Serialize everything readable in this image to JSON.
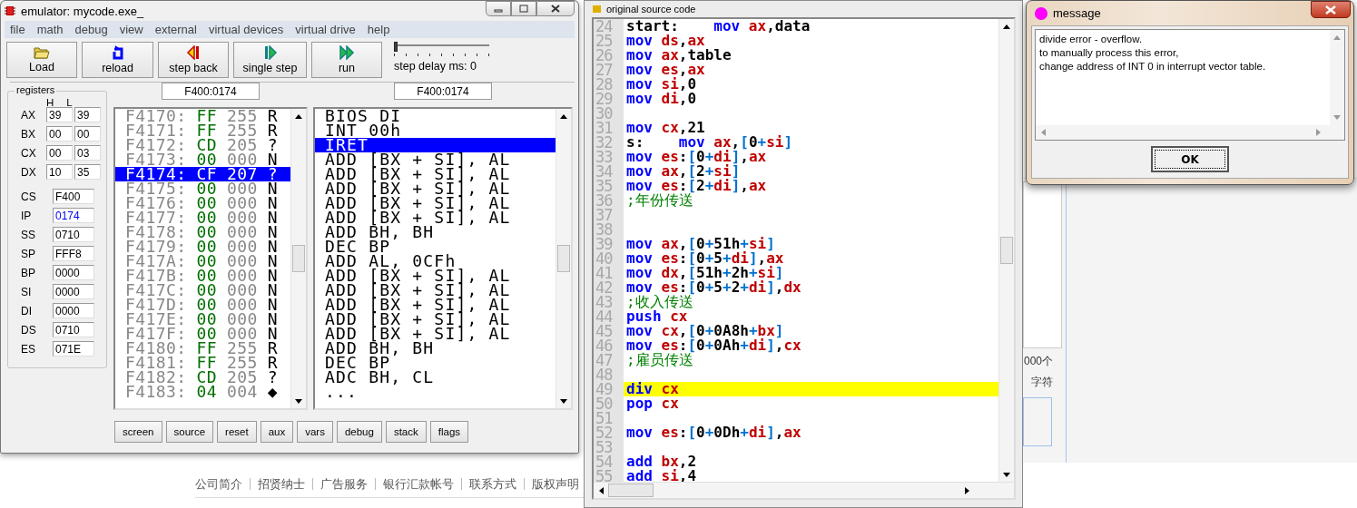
{
  "emulator": {
    "title": "emulator: mycode.exe_",
    "menu": [
      "file",
      "math",
      "debug",
      "view",
      "external",
      "virtual devices",
      "virtual drive",
      "help"
    ],
    "toolbar": [
      {
        "label": "Load",
        "kind": "load"
      },
      {
        "label": "reload",
        "kind": "reload"
      },
      {
        "label": "step back",
        "kind": "back"
      },
      {
        "label": "single step",
        "kind": "step"
      },
      {
        "label": "run",
        "kind": "run"
      }
    ],
    "step_delay": {
      "label": "step delay ms: 0",
      "level": 0
    },
    "registers": {
      "title": "registers",
      "col_h": "H",
      "col_l": "L",
      "pairs": [
        {
          "name": "AX",
          "h": "39",
          "l": "39"
        },
        {
          "name": "BX",
          "h": "00",
          "l": "00"
        },
        {
          "name": "CX",
          "h": "00",
          "l": "03"
        },
        {
          "name": "DX",
          "h": "10",
          "l": "35"
        }
      ],
      "singles": [
        {
          "name": "CS",
          "value": "F400",
          "changed": false
        },
        {
          "name": "IP",
          "value": "0174",
          "changed": true
        },
        {
          "name": "SS",
          "value": "0710",
          "changed": false
        },
        {
          "name": "SP",
          "value": "FFF8",
          "changed": false
        },
        {
          "name": "BP",
          "value": "0000",
          "changed": false
        },
        {
          "name": "SI",
          "value": "0000",
          "changed": false
        },
        {
          "name": "DI",
          "value": "0000",
          "changed": false
        },
        {
          "name": "DS",
          "value": "0710",
          "changed": false
        },
        {
          "name": "ES",
          "value": "071E",
          "changed": false
        }
      ]
    },
    "memory": {
      "address": "F400:0174",
      "rows": [
        {
          "address": "F4170:",
          "hex": "FF",
          "dec": "255",
          "char": "R",
          "selected": false
        },
        {
          "address": "F4171:",
          "hex": "FF",
          "dec": "255",
          "char": "R",
          "selected": false
        },
        {
          "address": "F4172:",
          "hex": "CD",
          "dec": "205",
          "char": "?",
          "selected": false
        },
        {
          "address": "F4173:",
          "hex": "00",
          "dec": "000",
          "char": "N",
          "selected": false
        },
        {
          "address": "F4174:",
          "hex": "CF",
          "dec": "207",
          "char": "?",
          "selected": true
        },
        {
          "address": "F4175:",
          "hex": "00",
          "dec": "000",
          "char": "N",
          "selected": false
        },
        {
          "address": "F4176:",
          "hex": "00",
          "dec": "000",
          "char": "N",
          "selected": false
        },
        {
          "address": "F4177:",
          "hex": "00",
          "dec": "000",
          "char": "N",
          "selected": false
        },
        {
          "address": "F4178:",
          "hex": "00",
          "dec": "000",
          "char": "N",
          "selected": false
        },
        {
          "address": "F4179:",
          "hex": "00",
          "dec": "000",
          "char": "N",
          "selected": false
        },
        {
          "address": "F417A:",
          "hex": "00",
          "dec": "000",
          "char": "N",
          "selected": false
        },
        {
          "address": "F417B:",
          "hex": "00",
          "dec": "000",
          "char": "N",
          "selected": false
        },
        {
          "address": "F417C:",
          "hex": "00",
          "dec": "000",
          "char": "N",
          "selected": false
        },
        {
          "address": "F417D:",
          "hex": "00",
          "dec": "000",
          "char": "N",
          "selected": false
        },
        {
          "address": "F417E:",
          "hex": "00",
          "dec": "000",
          "char": "N",
          "selected": false
        },
        {
          "address": "F417F:",
          "hex": "00",
          "dec": "000",
          "char": "N",
          "selected": false
        },
        {
          "address": "F4180:",
          "hex": "FF",
          "dec": "255",
          "char": "R",
          "selected": false
        },
        {
          "address": "F4181:",
          "hex": "FF",
          "dec": "255",
          "char": "R",
          "selected": false
        },
        {
          "address": "F4182:",
          "hex": "CD",
          "dec": "205",
          "char": "?",
          "selected": false
        },
        {
          "address": "F4183:",
          "hex": "04",
          "dec": "004",
          "char": "◆",
          "selected": false
        }
      ]
    },
    "disassembly": {
      "address": "F400:0174",
      "rows": [
        {
          "text": "BIOS DI",
          "selected": false
        },
        {
          "text": "INT 00h",
          "selected": false
        },
        {
          "text": "IRET",
          "selected": true
        },
        {
          "text": "ADD [BX + SI], AL",
          "selected": false
        },
        {
          "text": "ADD [BX + SI], AL",
          "selected": false
        },
        {
          "text": "ADD [BX + SI], AL",
          "selected": false
        },
        {
          "text": "ADD [BX + SI], AL",
          "selected": false
        },
        {
          "text": "ADD [BX + SI], AL",
          "selected": false
        },
        {
          "text": "ADD BH, BH",
          "selected": false
        },
        {
          "text": "DEC BP",
          "selected": false
        },
        {
          "text": "ADD AL, 0CFh",
          "selected": false
        },
        {
          "text": "ADD [BX + SI], AL",
          "selected": false
        },
        {
          "text": "ADD [BX + SI], AL",
          "selected": false
        },
        {
          "text": "ADD [BX + SI], AL",
          "selected": false
        },
        {
          "text": "ADD [BX + SI], AL",
          "selected": false
        },
        {
          "text": "ADD [BX + SI], AL",
          "selected": false
        },
        {
          "text": "ADD BH, BH",
          "selected": false
        },
        {
          "text": "DEC BP",
          "selected": false
        },
        {
          "text": "ADC BH, CL",
          "selected": false
        },
        {
          "text": "...",
          "selected": false
        }
      ]
    },
    "buttons": [
      "screen",
      "source",
      "reset",
      "aux",
      "vars",
      "debug",
      "stack",
      "flags"
    ]
  },
  "source": {
    "title": "original source code",
    "lines": [
      {
        "number": "24",
        "highlighted": false,
        "tokens": [
          {
            "kind": "text",
            "text": "start:    "
          },
          {
            "kind": "kw",
            "text": "mov "
          },
          {
            "kind": "reg",
            "text": "ax"
          },
          {
            "kind": "text",
            "text": ",data"
          }
        ]
      },
      {
        "number": "25",
        "highlighted": false,
        "tokens": [
          {
            "kind": "kw",
            "text": "mov "
          },
          {
            "kind": "reg",
            "text": "ds"
          },
          {
            "kind": "text",
            "text": ","
          },
          {
            "kind": "reg",
            "text": "ax"
          }
        ]
      },
      {
        "number": "26",
        "highlighted": false,
        "tokens": [
          {
            "kind": "kw",
            "text": "mov "
          },
          {
            "kind": "reg",
            "text": "ax"
          },
          {
            "kind": "text",
            "text": ",table"
          }
        ]
      },
      {
        "number": "27",
        "highlighted": false,
        "tokens": [
          {
            "kind": "kw",
            "text": "mov "
          },
          {
            "kind": "reg",
            "text": "es"
          },
          {
            "kind": "text",
            "text": ","
          },
          {
            "kind": "reg",
            "text": "ax"
          }
        ]
      },
      {
        "number": "28",
        "highlighted": false,
        "tokens": [
          {
            "kind": "kw",
            "text": "mov "
          },
          {
            "kind": "reg",
            "text": "si"
          },
          {
            "kind": "text",
            "text": ",0"
          }
        ]
      },
      {
        "number": "29",
        "highlighted": false,
        "tokens": [
          {
            "kind": "kw",
            "text": "mov "
          },
          {
            "kind": "reg",
            "text": "di"
          },
          {
            "kind": "text",
            "text": ",0"
          }
        ]
      },
      {
        "number": "30",
        "highlighted": false
      },
      {
        "number": "31",
        "highlighted": false,
        "tokens": [
          {
            "kind": "kw",
            "text": "mov "
          },
          {
            "kind": "reg",
            "text": "cx"
          },
          {
            "kind": "text",
            "text": ",21"
          }
        ]
      },
      {
        "number": "32",
        "highlighted": false,
        "tokens": [
          {
            "kind": "text",
            "text": "s:    "
          },
          {
            "kind": "kw",
            "text": "mov "
          },
          {
            "kind": "reg",
            "text": "ax"
          },
          {
            "kind": "text",
            "text": ","
          },
          {
            "kind": "punct",
            "text": "["
          },
          {
            "kind": "text",
            "text": "0"
          },
          {
            "kind": "punct",
            "text": "+"
          },
          {
            "kind": "reg",
            "text": "si"
          },
          {
            "kind": "punct",
            "text": "]"
          }
        ]
      },
      {
        "number": "33",
        "highlighted": false,
        "tokens": [
          {
            "kind": "kw",
            "text": "mov "
          },
          {
            "kind": "reg",
            "text": "es"
          },
          {
            "kind": "text",
            "text": ":"
          },
          {
            "kind": "punct",
            "text": "["
          },
          {
            "kind": "text",
            "text": "0"
          },
          {
            "kind": "punct",
            "text": "+"
          },
          {
            "kind": "reg",
            "text": "di"
          },
          {
            "kind": "punct",
            "text": "]"
          },
          {
            "kind": "text",
            "text": ","
          },
          {
            "kind": "reg",
            "text": "ax"
          }
        ]
      },
      {
        "number": "34",
        "highlighted": false,
        "tokens": [
          {
            "kind": "kw",
            "text": "mov "
          },
          {
            "kind": "reg",
            "text": "ax"
          },
          {
            "kind": "text",
            "text": ","
          },
          {
            "kind": "punct",
            "text": "["
          },
          {
            "kind": "text",
            "text": "2"
          },
          {
            "kind": "punct",
            "text": "+"
          },
          {
            "kind": "reg",
            "text": "si"
          },
          {
            "kind": "punct",
            "text": "]"
          }
        ]
      },
      {
        "number": "35",
        "highlighted": false,
        "tokens": [
          {
            "kind": "kw",
            "text": "mov "
          },
          {
            "kind": "reg",
            "text": "es"
          },
          {
            "kind": "text",
            "text": ":"
          },
          {
            "kind": "punct",
            "text": "["
          },
          {
            "kind": "text",
            "text": "2"
          },
          {
            "kind": "punct",
            "text": "+"
          },
          {
            "kind": "reg",
            "text": "di"
          },
          {
            "kind": "punct",
            "text": "]"
          },
          {
            "kind": "text",
            "text": ","
          },
          {
            "kind": "reg",
            "text": "ax"
          }
        ]
      },
      {
        "number": "36",
        "highlighted": false,
        "tokens": [
          {
            "kind": "comment",
            "text": ";年份传送"
          }
        ]
      },
      {
        "number": "37",
        "highlighted": false
      },
      {
        "number": "38",
        "highlighted": false
      },
      {
        "number": "39",
        "highlighted": false,
        "tokens": [
          {
            "kind": "kw",
            "text": "mov "
          },
          {
            "kind": "reg",
            "text": "ax"
          },
          {
            "kind": "text",
            "text": ","
          },
          {
            "kind": "punct",
            "text": "["
          },
          {
            "kind": "text",
            "text": "0"
          },
          {
            "kind": "punct",
            "text": "+"
          },
          {
            "kind": "text",
            "text": "51h"
          },
          {
            "kind": "punct",
            "text": "+"
          },
          {
            "kind": "reg",
            "text": "si"
          },
          {
            "kind": "punct",
            "text": "]"
          }
        ]
      },
      {
        "number": "40",
        "highlighted": false,
        "tokens": [
          {
            "kind": "kw",
            "text": "mov "
          },
          {
            "kind": "reg",
            "text": "es"
          },
          {
            "kind": "text",
            "text": ":"
          },
          {
            "kind": "punct",
            "text": "["
          },
          {
            "kind": "text",
            "text": "0"
          },
          {
            "kind": "punct",
            "text": "+"
          },
          {
            "kind": "text",
            "text": "5"
          },
          {
            "kind": "punct",
            "text": "+"
          },
          {
            "kind": "reg",
            "text": "di"
          },
          {
            "kind": "punct",
            "text": "]"
          },
          {
            "kind": "text",
            "text": ","
          },
          {
            "kind": "reg",
            "text": "ax"
          }
        ]
      },
      {
        "number": "41",
        "highlighted": false,
        "tokens": [
          {
            "kind": "kw",
            "text": "mov "
          },
          {
            "kind": "reg",
            "text": "dx"
          },
          {
            "kind": "text",
            "text": ","
          },
          {
            "kind": "punct",
            "text": "["
          },
          {
            "kind": "text",
            "text": "51h"
          },
          {
            "kind": "punct",
            "text": "+"
          },
          {
            "kind": "text",
            "text": "2h"
          },
          {
            "kind": "punct",
            "text": "+"
          },
          {
            "kind": "reg",
            "text": "si"
          },
          {
            "kind": "punct",
            "text": "]"
          }
        ]
      },
      {
        "number": "42",
        "highlighted": false,
        "tokens": [
          {
            "kind": "kw",
            "text": "mov "
          },
          {
            "kind": "reg",
            "text": "es"
          },
          {
            "kind": "text",
            "text": ":"
          },
          {
            "kind": "punct",
            "text": "["
          },
          {
            "kind": "text",
            "text": "0"
          },
          {
            "kind": "punct",
            "text": "+"
          },
          {
            "kind": "text",
            "text": "5"
          },
          {
            "kind": "punct",
            "text": "+"
          },
          {
            "kind": "text",
            "text": "2"
          },
          {
            "kind": "punct",
            "text": "+"
          },
          {
            "kind": "reg",
            "text": "di"
          },
          {
            "kind": "punct",
            "text": "]"
          },
          {
            "kind": "text",
            "text": ","
          },
          {
            "kind": "reg",
            "text": "dx"
          }
        ]
      },
      {
        "number": "43",
        "highlighted": false,
        "tokens": [
          {
            "kind": "comment",
            "text": ";收入传送"
          }
        ]
      },
      {
        "number": "44",
        "highlighted": false,
        "tokens": [
          {
            "kind": "kw",
            "text": "push "
          },
          {
            "kind": "reg",
            "text": "cx"
          }
        ]
      },
      {
        "number": "45",
        "highlighted": false,
        "tokens": [
          {
            "kind": "kw",
            "text": "mov "
          },
          {
            "kind": "reg",
            "text": "cx"
          },
          {
            "kind": "text",
            "text": ","
          },
          {
            "kind": "punct",
            "text": "["
          },
          {
            "kind": "text",
            "text": "0"
          },
          {
            "kind": "punct",
            "text": "+"
          },
          {
            "kind": "text",
            "text": "0A8h"
          },
          {
            "kind": "punct",
            "text": "+"
          },
          {
            "kind": "reg",
            "text": "bx"
          },
          {
            "kind": "punct",
            "text": "]"
          }
        ]
      },
      {
        "number": "46",
        "highlighted": false,
        "tokens": [
          {
            "kind": "kw",
            "text": "mov "
          },
          {
            "kind": "reg",
            "text": "es"
          },
          {
            "kind": "text",
            "text": ":"
          },
          {
            "kind": "punct",
            "text": "["
          },
          {
            "kind": "text",
            "text": "0"
          },
          {
            "kind": "punct",
            "text": "+"
          },
          {
            "kind": "text",
            "text": "0Ah"
          },
          {
            "kind": "punct",
            "text": "+"
          },
          {
            "kind": "reg",
            "text": "di"
          },
          {
            "kind": "punct",
            "text": "]"
          },
          {
            "kind": "text",
            "text": ","
          },
          {
            "kind": "reg",
            "text": "cx"
          }
        ]
      },
      {
        "number": "47",
        "highlighted": false,
        "tokens": [
          {
            "kind": "comment",
            "text": ";雇员传送"
          }
        ]
      },
      {
        "number": "48",
        "highlighted": false
      },
      {
        "number": "49",
        "highlighted": true,
        "tokens": [
          {
            "kind": "kw",
            "text": "div "
          },
          {
            "kind": "reg",
            "text": "cx"
          }
        ]
      },
      {
        "number": "50",
        "highlighted": false,
        "tokens": [
          {
            "kind": "kw",
            "text": "pop "
          },
          {
            "kind": "reg",
            "text": "cx"
          }
        ]
      },
      {
        "number": "51",
        "highlighted": false
      },
      {
        "number": "52",
        "highlighted": false,
        "tokens": [
          {
            "kind": "kw",
            "text": "mov "
          },
          {
            "kind": "reg",
            "text": "es"
          },
          {
            "kind": "text",
            "text": ":"
          },
          {
            "kind": "punct",
            "text": "["
          },
          {
            "kind": "text",
            "text": "0"
          },
          {
            "kind": "punct",
            "text": "+"
          },
          {
            "kind": "text",
            "text": "0Dh"
          },
          {
            "kind": "punct",
            "text": "+"
          },
          {
            "kind": "reg",
            "text": "di"
          },
          {
            "kind": "punct",
            "text": "]"
          },
          {
            "kind": "text",
            "text": ","
          },
          {
            "kind": "reg",
            "text": "ax"
          }
        ]
      },
      {
        "number": "53",
        "highlighted": false
      },
      {
        "number": "54",
        "highlighted": false,
        "tokens": [
          {
            "kind": "kw",
            "text": "add "
          },
          {
            "kind": "reg",
            "text": "bx"
          },
          {
            "kind": "text",
            "text": ",2"
          }
        ]
      },
      {
        "number": "55",
        "highlighted": false,
        "tokens": [
          {
            "kind": "kw",
            "text": "add "
          },
          {
            "kind": "reg",
            "text": "si"
          },
          {
            "kind": "text",
            "text": ",4"
          }
        ]
      }
    ]
  },
  "message": {
    "title": "message",
    "lines": [
      "divide error - overflow.",
      "to manually process this error,",
      "change address of INT 0 in interrupt vector table."
    ],
    "button": "OK"
  },
  "page": {
    "counter": "000个",
    "unit": "字符",
    "footer_links": [
      "公司简介",
      "招贤纳士",
      "广告服务",
      "银行汇款帐号",
      "联系方式",
      "版权声明"
    ]
  }
}
